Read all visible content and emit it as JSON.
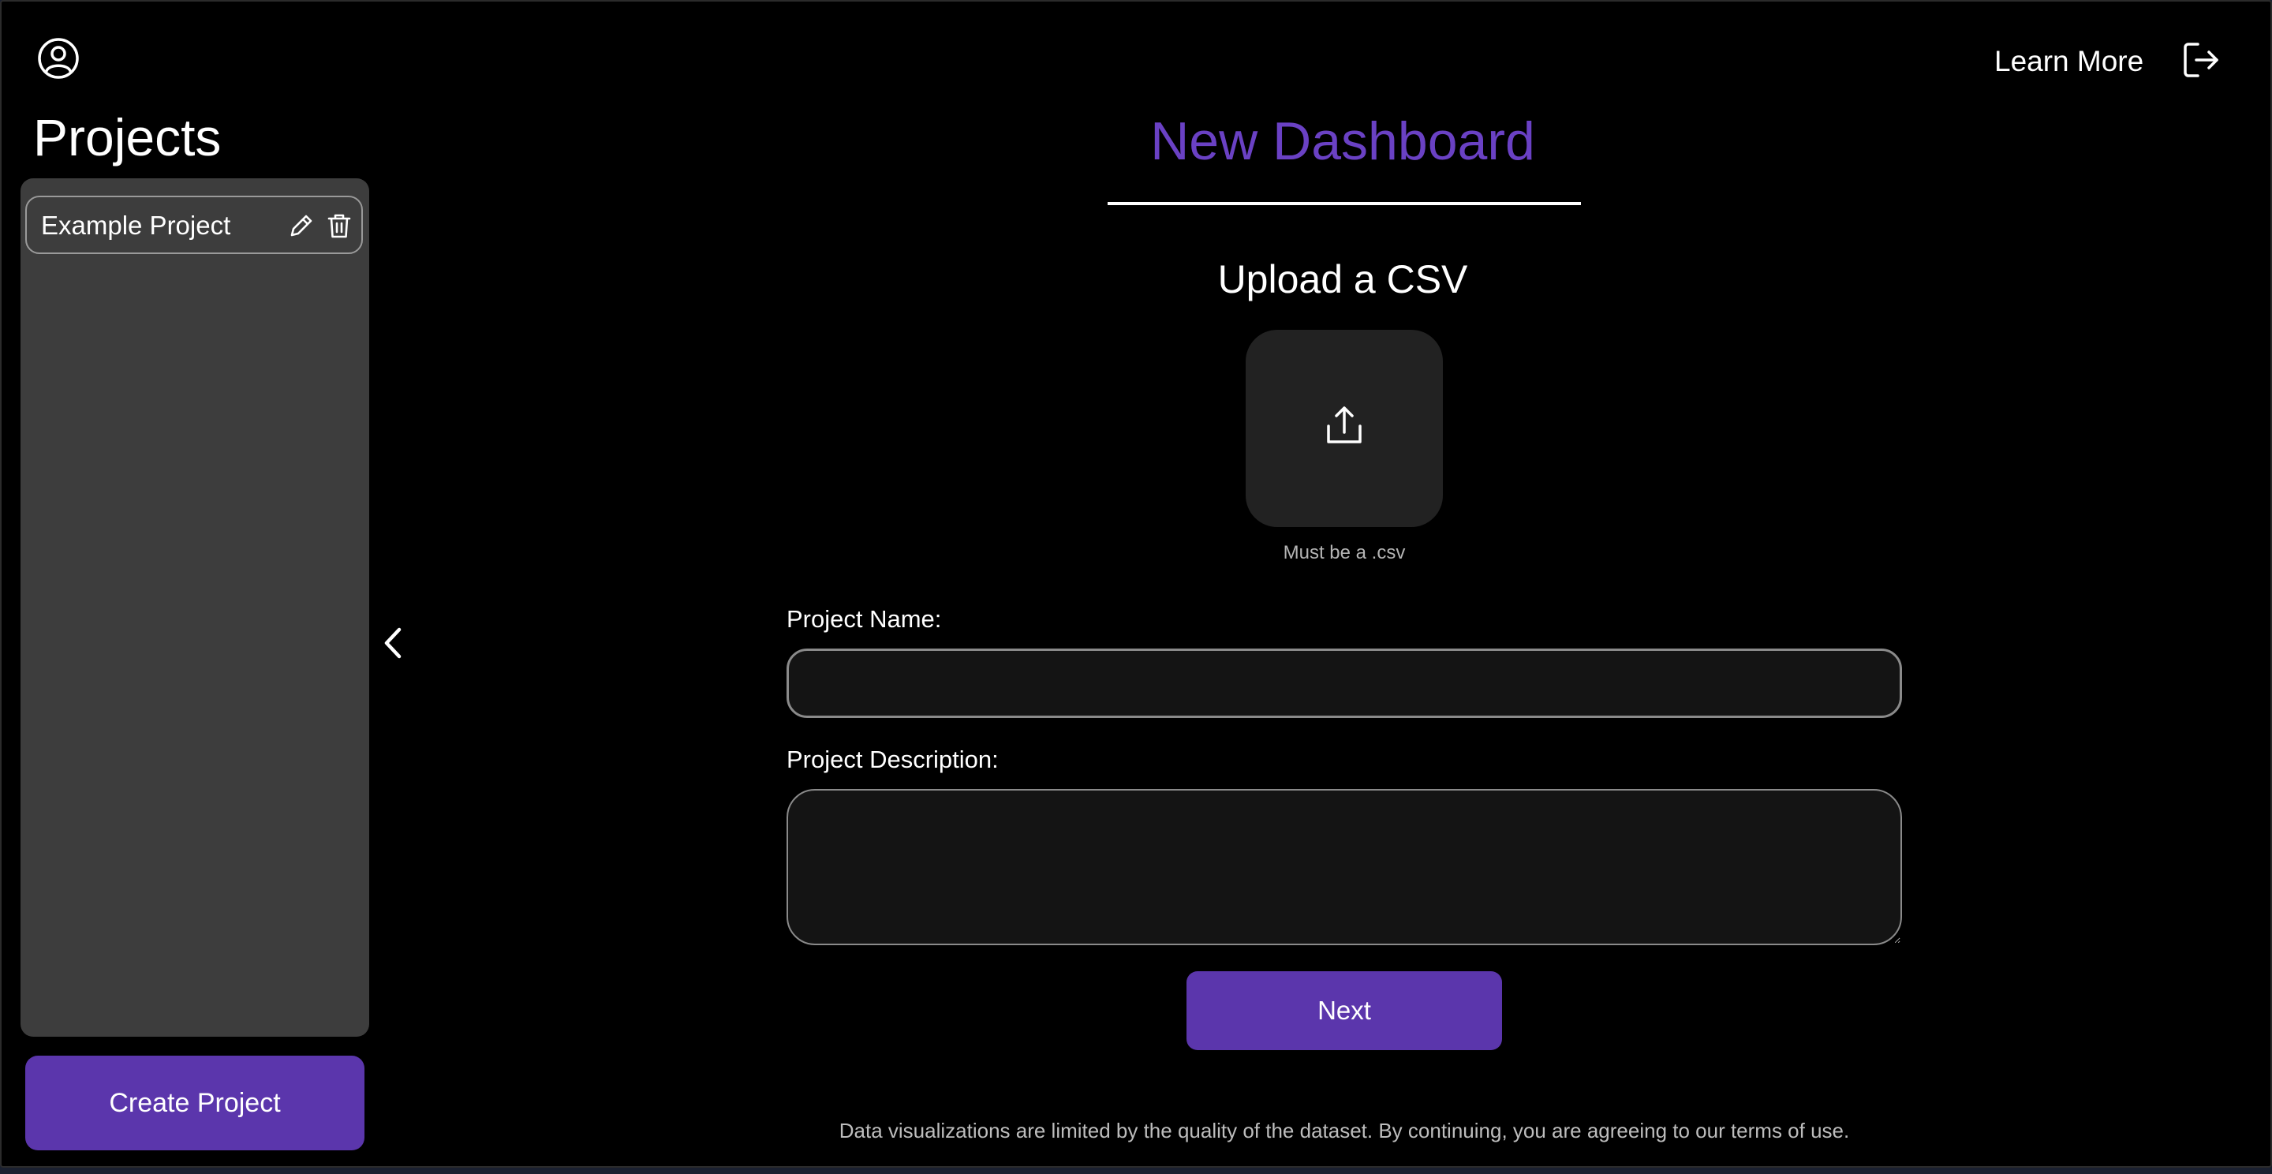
{
  "header": {
    "learn_more_label": "Learn More",
    "profile_icon": "user-circle-icon",
    "logout_icon": "logout-icon"
  },
  "sidebar": {
    "title": "Projects",
    "projects": [
      {
        "label": "Example Project",
        "edit_icon": "pencil-icon",
        "delete_icon": "trash-icon"
      }
    ],
    "create_label": "Create Project",
    "collapse_icon": "chevron-left-icon"
  },
  "main": {
    "title": "New Dashboard",
    "upload_heading": "Upload a CSV",
    "upload_icon": "upload-icon",
    "upload_hint": "Must be a .csv",
    "name_label": "Project Name:",
    "name_value": "",
    "description_label": "Project Description:",
    "description_value": "",
    "next_label": "Next",
    "disclaimer": "Data visualizations are limited by the quality of the dataset. By continuing, you are agreeing to our terms of use."
  },
  "colors": {
    "accent": "#5b36ac",
    "title": "#6a41c4",
    "background": "#000000",
    "sidebar_panel": "#3d3d3d"
  }
}
